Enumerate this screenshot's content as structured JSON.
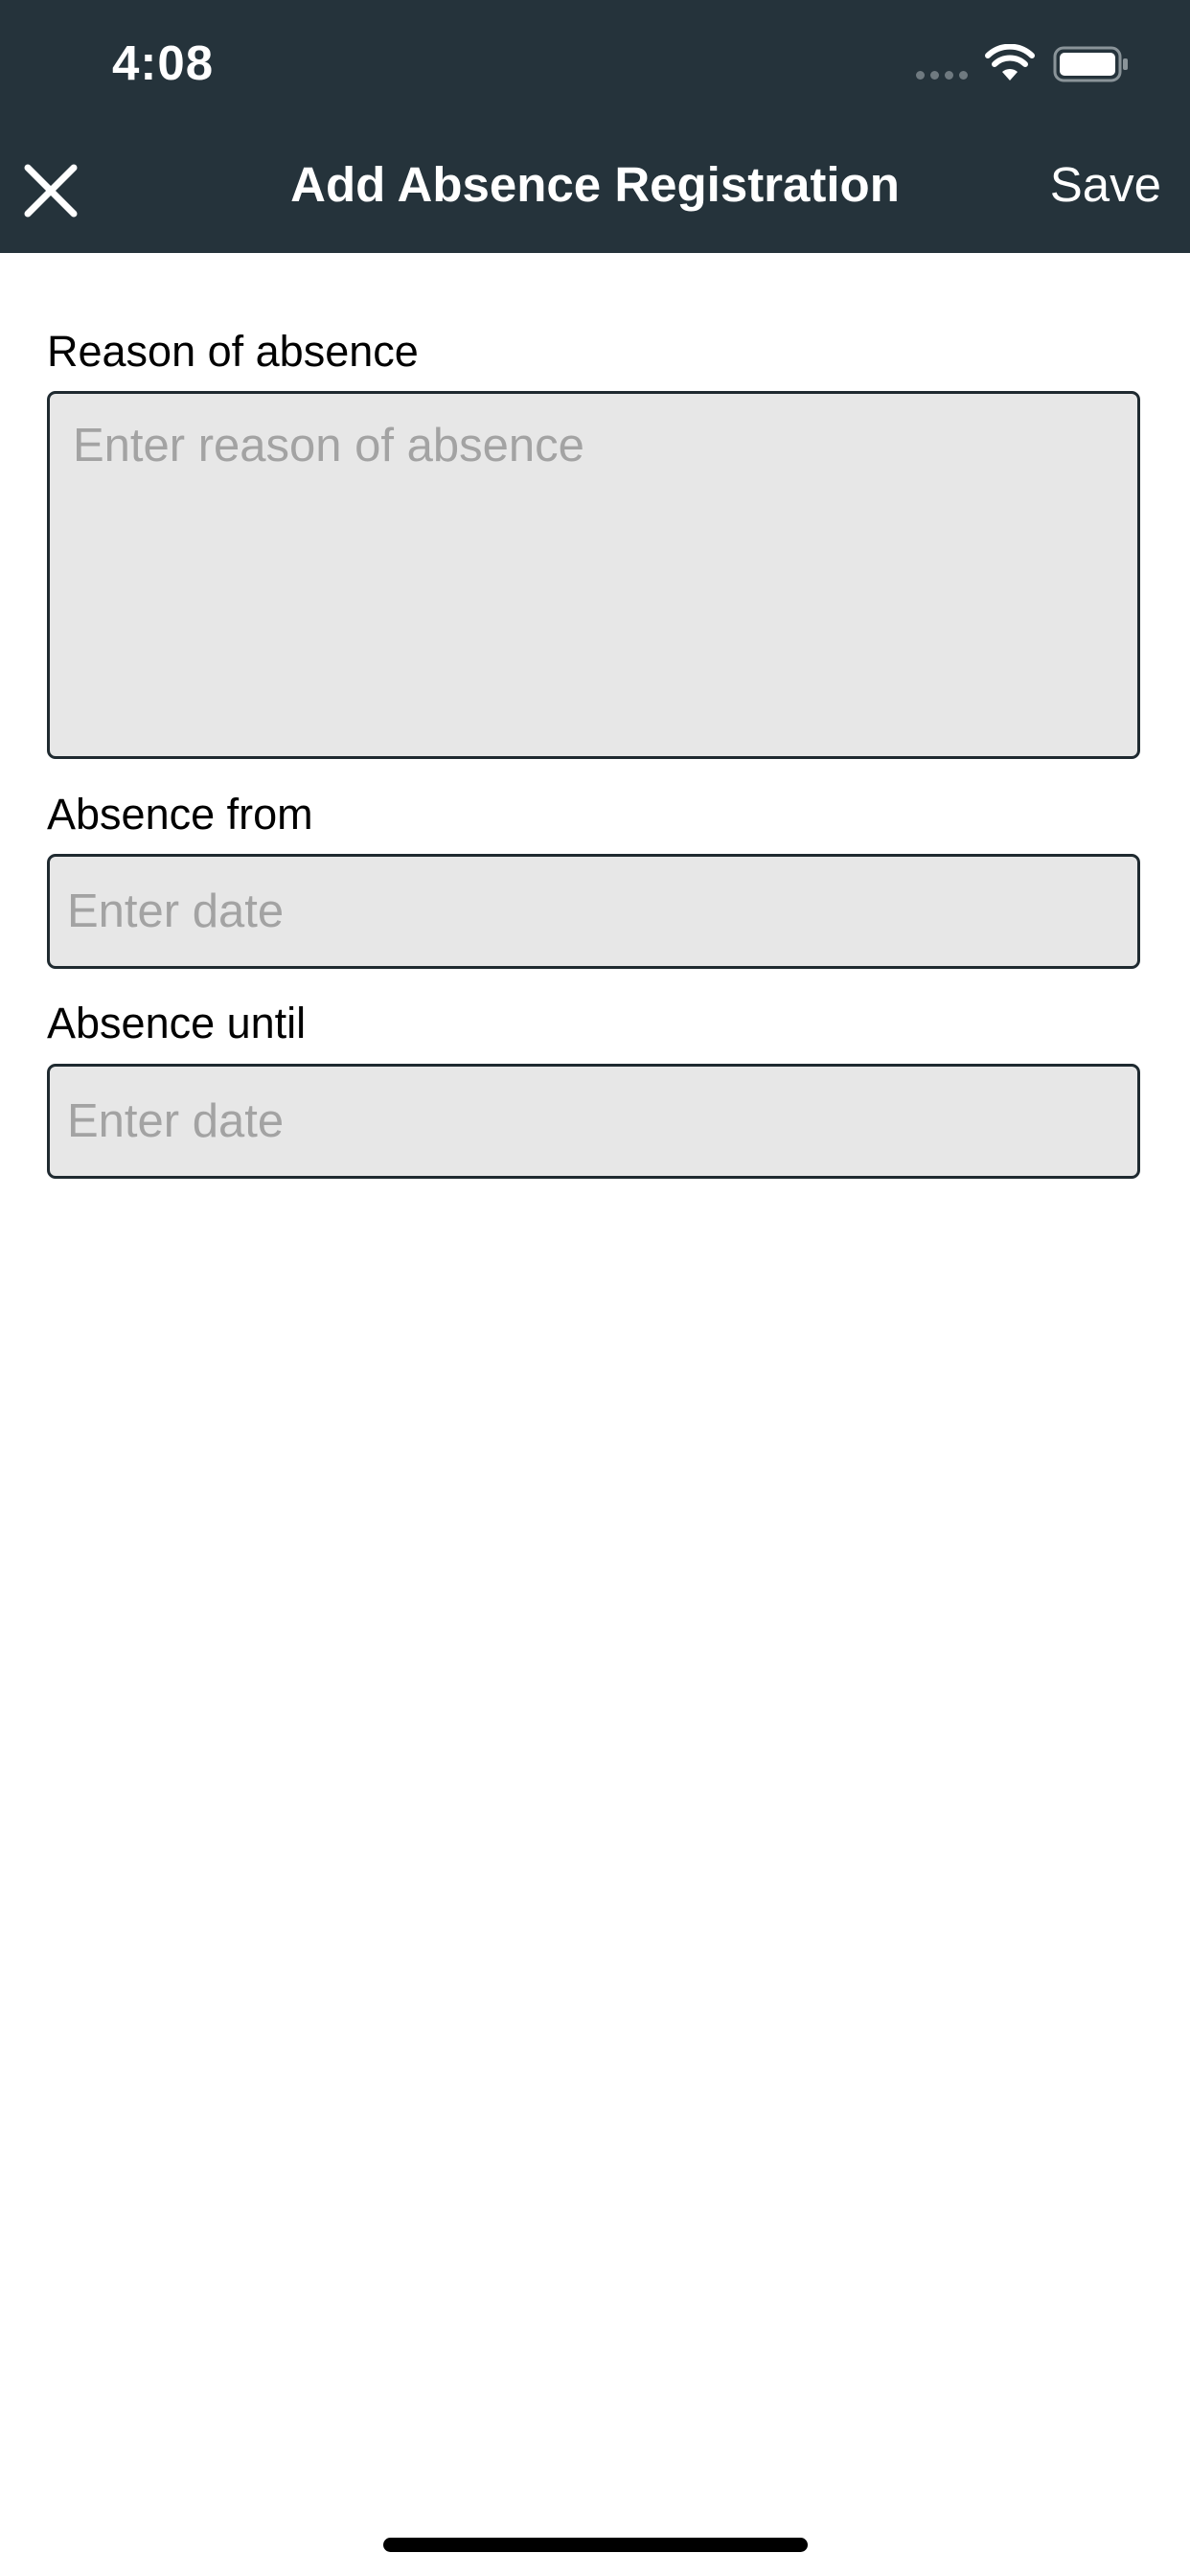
{
  "status_bar": {
    "time": "4:08",
    "icons": [
      "cellular-signal-icon",
      "wifi-icon",
      "battery-icon"
    ]
  },
  "nav_bar": {
    "close_icon": "close-icon",
    "title": "Add Absence Registration",
    "save_label": "Save"
  },
  "form": {
    "reason": {
      "label": "Reason of absence",
      "placeholder": "Enter reason of absence",
      "value": ""
    },
    "absence_from": {
      "label": "Absence from",
      "placeholder": "Enter date",
      "value": ""
    },
    "absence_until": {
      "label": "Absence until",
      "placeholder": "Enter date",
      "value": ""
    }
  },
  "colors": {
    "header_background": "#25333b",
    "field_background": "#e7e7e7",
    "field_border": "#1f2a30",
    "placeholder_text": "#a3a3a3"
  }
}
